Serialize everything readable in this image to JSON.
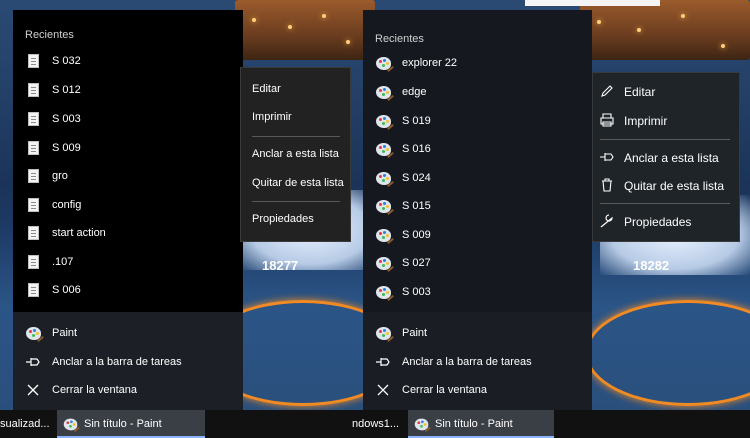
{
  "left": {
    "recent_header": "Recientes",
    "recent_items": [
      "S 032",
      "S 012",
      "S 003",
      "S 009",
      "gro",
      "config",
      "start action",
      ".107",
      "S 006"
    ],
    "bottom": [
      "Paint",
      "Anclar a la barra de tareas",
      "Cerrar la ventana"
    ],
    "context_menu": [
      "Editar",
      "Imprimir",
      "Anclar a esta lista",
      "Quitar de esta lista",
      "Propiedades"
    ],
    "counter": "18277",
    "taskbar_left_text": "sualizad...",
    "taskbar_app": "Sin título - Paint"
  },
  "right": {
    "recent_header": "Recientes",
    "recent_items": [
      "explorer 22",
      "edge",
      "S 019",
      "S 016",
      "S 024",
      "S 015",
      "S 009",
      "S 027",
      "S 003"
    ],
    "bottom": [
      "Paint",
      "Anclar a la barra de tareas",
      "Cerrar la ventana"
    ],
    "context_menu": [
      "Editar",
      "Imprimir",
      "Anclar a esta lista",
      "Quitar de esta lista",
      "Propiedades"
    ],
    "counter": "18282",
    "taskbar_left_text": "ndows1...",
    "taskbar_app": "Sin título - Paint"
  },
  "icons": {
    "document": "document-icon",
    "paint": "paint-icon",
    "pin": "pin-icon",
    "close": "close-icon",
    "edit": "pencil-icon",
    "print": "printer-icon",
    "delete": "trash-icon",
    "properties": "wrench-icon"
  },
  "colors": {
    "jumplist_bg": "#000000",
    "context_bg": "#222222",
    "taskbar_active": "#3a3f46",
    "accent": "#8ab4ff"
  }
}
